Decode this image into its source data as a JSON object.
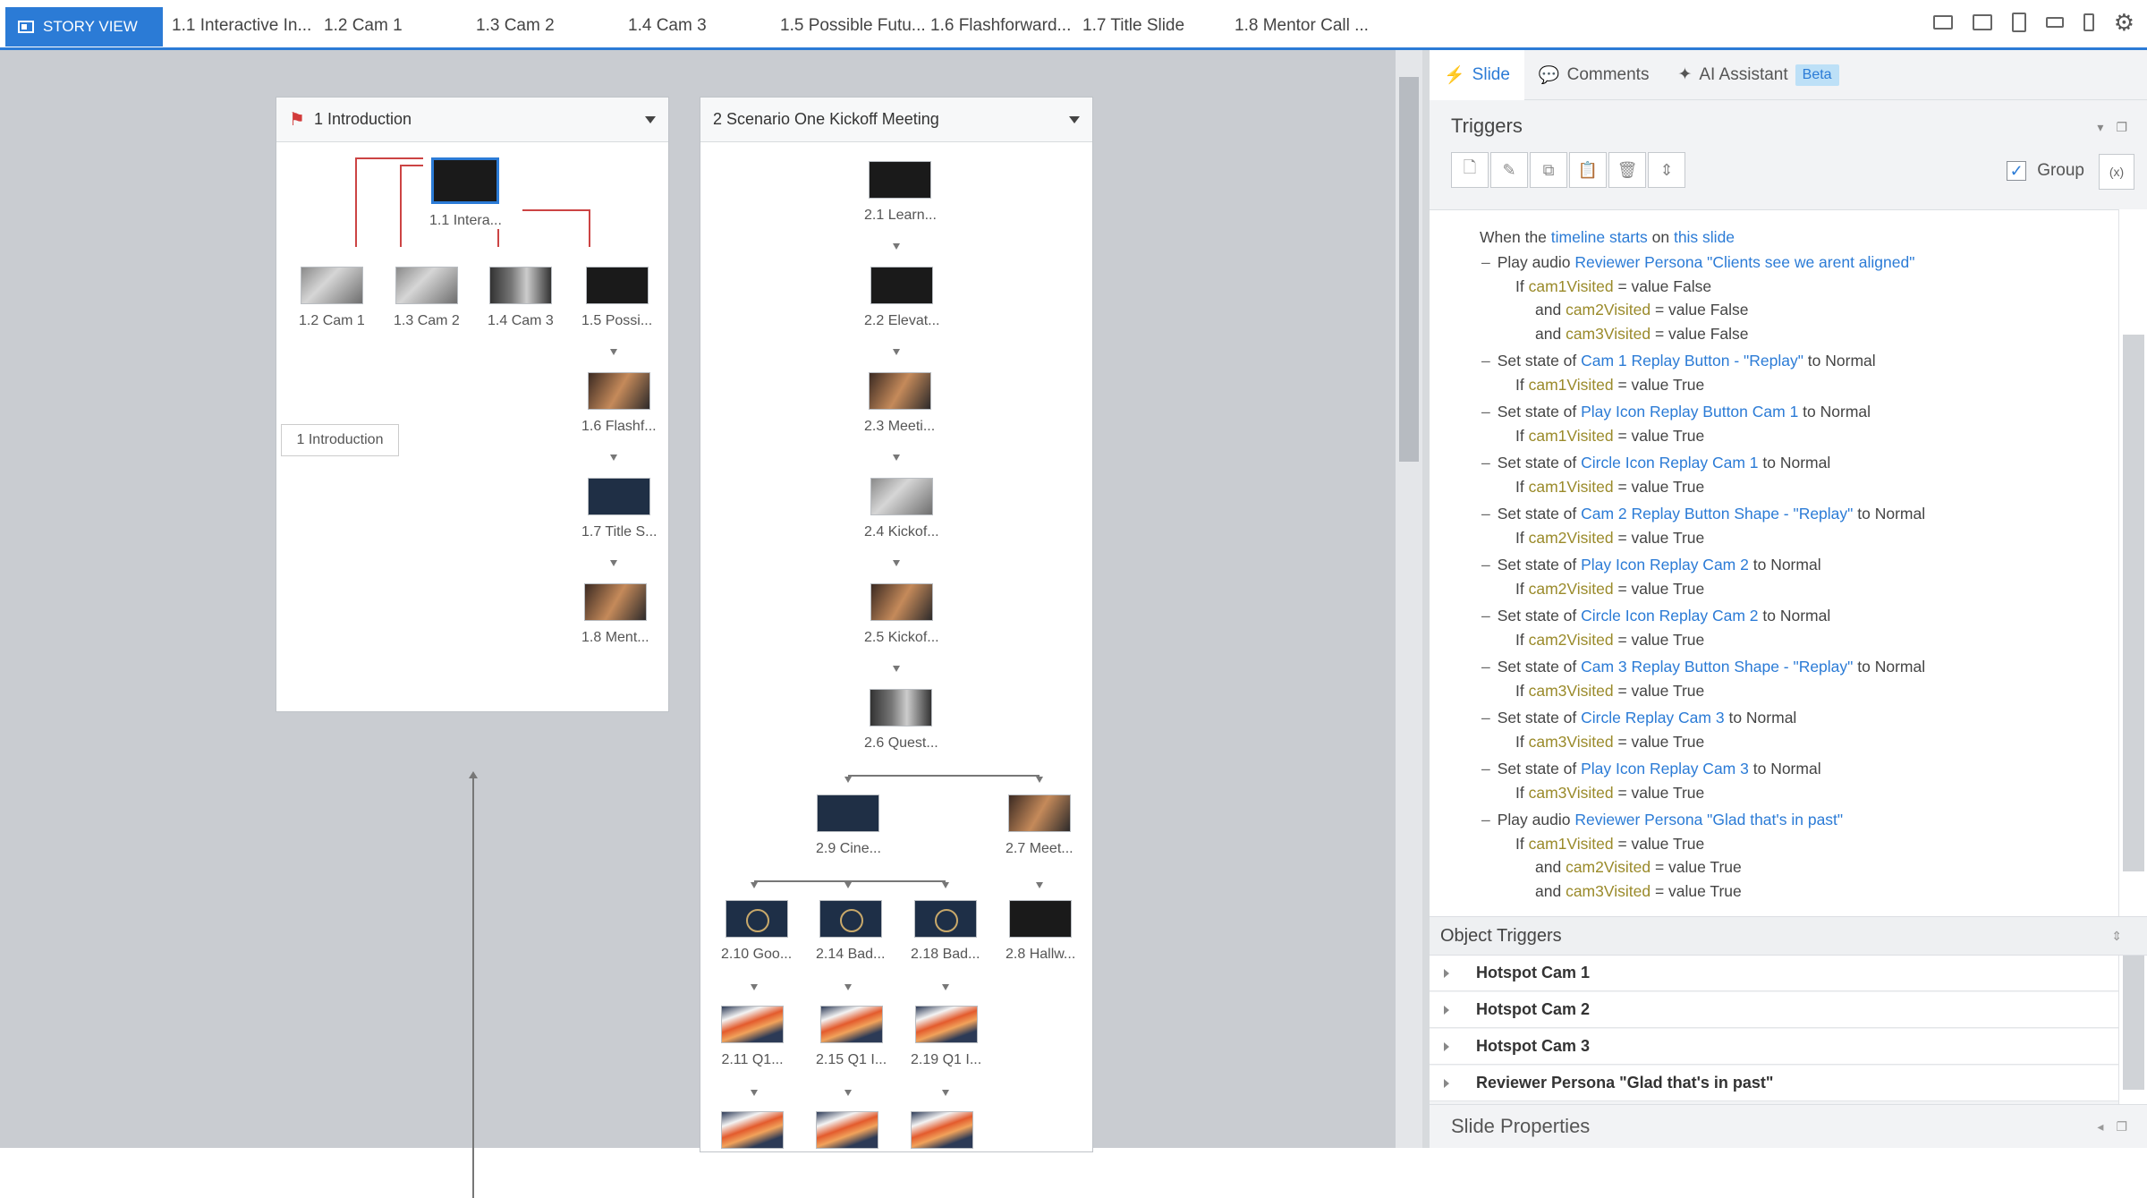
{
  "topbar": {
    "story_view": "STORY VIEW",
    "tabs": [
      "1.1 Interactive In...",
      "1.2 Cam 1",
      "1.3 Cam 2",
      "1.4 Cam 3",
      "1.5 Possible Futu...",
      "1.6 Flashforward...",
      "1.7 Title Slide",
      "1.8 Mentor Call ..."
    ]
  },
  "scenes": {
    "intro": {
      "title": "1 Introduction",
      "label_box": "1 Introduction",
      "slides": [
        "1.1 Intera...",
        "1.2 Cam 1",
        "1.3 Cam 2",
        "1.4 Cam 3",
        "1.5 Possi...",
        "1.6 Flashf...",
        "1.7 Title S...",
        "1.8 Ment..."
      ]
    },
    "scenario": {
      "title": "2 Scenario One Kickoff Meeting",
      "slides": [
        "2.1 Learn...",
        "2.2 Elevat...",
        "2.3 Meeti...",
        "2.4 Kickof...",
        "2.5 Kickof...",
        "2.6 Quest...",
        "2.9 Cine...",
        "2.7 Meet...",
        "2.10 Goo...",
        "2.14 Bad...",
        "2.18 Bad...",
        "2.8 Hallw...",
        "2.11 Q1...",
        "2.15 Q1 I...",
        "2.19 Q1 I..."
      ]
    }
  },
  "panel": {
    "tabs": {
      "slide": "Slide",
      "comments": "Comments",
      "ai": "AI Assistant",
      "beta": "Beta"
    },
    "triggers_title": "Triggers",
    "group_label": "Group",
    "header_line": {
      "pre": "When the ",
      "timeline": "timeline",
      "starts": " starts",
      "on": " on ",
      "this_slide": "this slide"
    },
    "trigger_list": [
      {
        "action": "Play audio ",
        "target": "Reviewer Persona \"Clients see we arent aligned\"",
        "to": "",
        "state": "",
        "conds": [
          {
            "prefix": "If ",
            "var": "cam1Visited",
            "mid": " = value ",
            "val": "False"
          },
          {
            "prefix": "and ",
            "var": "cam2Visited",
            "mid": " = value ",
            "val": "False"
          },
          {
            "prefix": "and ",
            "var": "cam3Visited",
            "mid": " = value ",
            "val": "False"
          }
        ]
      },
      {
        "action": "Set state of ",
        "target": "Cam 1 Replay Button - \"Replay\"",
        "to": " to ",
        "state": "Normal",
        "conds": [
          {
            "prefix": "If ",
            "var": "cam1Visited",
            "mid": " = value ",
            "val": "True"
          }
        ]
      },
      {
        "action": "Set state of ",
        "target": "Play Icon Replay Button Cam 1",
        "to": " to ",
        "state": "Normal",
        "conds": [
          {
            "prefix": "If ",
            "var": "cam1Visited",
            "mid": " = value ",
            "val": "True"
          }
        ]
      },
      {
        "action": "Set state of ",
        "target": "Circle Icon Replay Cam 1",
        "to": " to ",
        "state": "Normal",
        "conds": [
          {
            "prefix": "If ",
            "var": "cam1Visited",
            "mid": " = value ",
            "val": "True"
          }
        ]
      },
      {
        "action": "Set state of ",
        "target": "Cam 2 Replay Button Shape - \"Replay\"",
        "to": " to ",
        "state": "Normal",
        "conds": [
          {
            "prefix": "If ",
            "var": "cam2Visited",
            "mid": " = value ",
            "val": "True"
          }
        ]
      },
      {
        "action": "Set state of ",
        "target": "Play Icon Replay Cam 2",
        "to": " to ",
        "state": "Normal",
        "conds": [
          {
            "prefix": "If ",
            "var": "cam2Visited",
            "mid": " = value ",
            "val": "True"
          }
        ]
      },
      {
        "action": "Set state of ",
        "target": "Circle Icon Replay Cam 2",
        "to": " to ",
        "state": "Normal",
        "conds": [
          {
            "prefix": "If ",
            "var": "cam2Visited",
            "mid": " = value ",
            "val": "True"
          }
        ]
      },
      {
        "action": "Set state of ",
        "target": "Cam 3 Replay Button Shape - \"Replay\"",
        "to": " to ",
        "state": "Normal",
        "conds": [
          {
            "prefix": "If ",
            "var": "cam3Visited",
            "mid": " = value ",
            "val": "True"
          }
        ]
      },
      {
        "action": "Set state of ",
        "target": "Circle Replay Cam 3",
        "to": " to ",
        "state": "Normal",
        "conds": [
          {
            "prefix": "If ",
            "var": "cam3Visited",
            "mid": " = value ",
            "val": "True"
          }
        ]
      },
      {
        "action": "Set state of ",
        "target": "Play Icon Replay Cam 3",
        "to": " to ",
        "state": "Normal",
        "conds": [
          {
            "prefix": "If ",
            "var": "cam3Visited",
            "mid": " = value ",
            "val": "True"
          }
        ]
      },
      {
        "action": "Play audio ",
        "target": "Reviewer Persona \"Glad that's in past\"",
        "to": "",
        "state": "",
        "conds": [
          {
            "prefix": "If ",
            "var": "cam1Visited",
            "mid": " = value ",
            "val": "True"
          },
          {
            "prefix": "and ",
            "var": "cam2Visited",
            "mid": " = value ",
            "val": "True"
          },
          {
            "prefix": "and ",
            "var": "cam3Visited",
            "mid": " = value ",
            "val": "True"
          }
        ]
      }
    ],
    "object_triggers_title": "Object Triggers",
    "object_triggers": [
      "Hotspot Cam 1",
      "Hotspot Cam 2",
      "Hotspot Cam 3",
      "Reviewer Persona \"Glad that's in past\""
    ],
    "slide_properties": "Slide Properties"
  },
  "colors": {
    "accent": "#2b7bd6",
    "variable": "#9a8a2a",
    "link_red": "#cc4444"
  }
}
